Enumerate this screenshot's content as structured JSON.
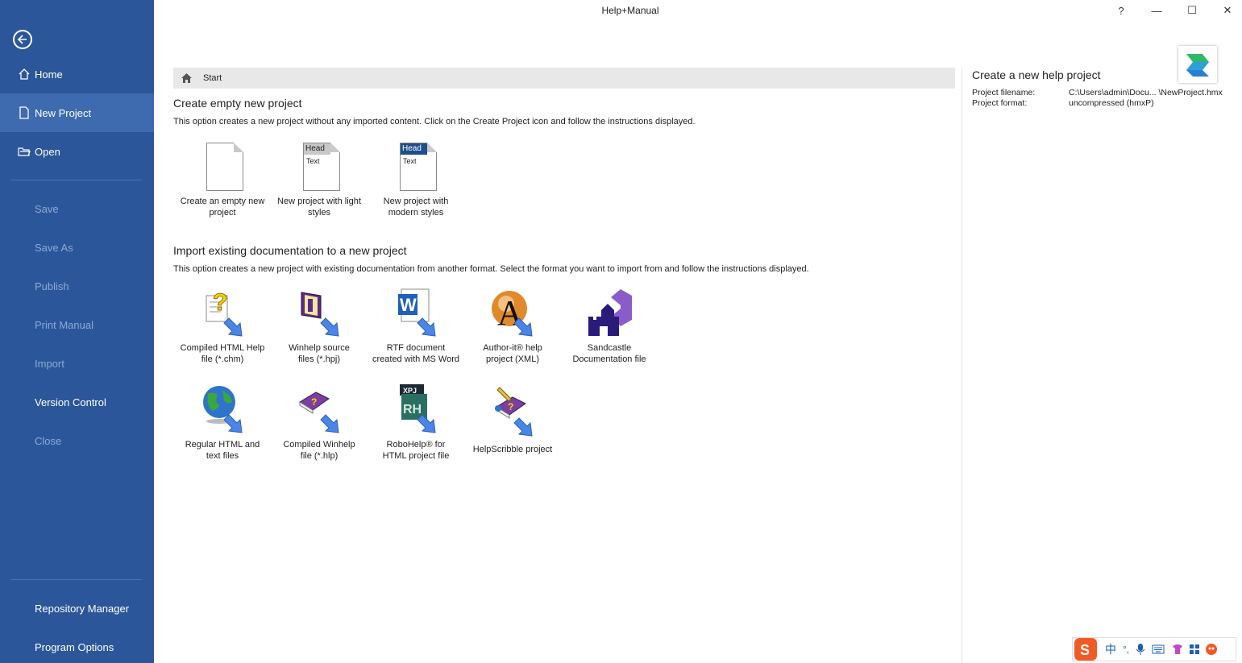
{
  "window": {
    "title": "Help+Manual",
    "help_label": "?",
    "min_label": "—",
    "max_label": "☐",
    "close_label": "✕"
  },
  "sidebar": {
    "items": [
      {
        "label": "Home",
        "icon": "home-icon",
        "state": "normal"
      },
      {
        "label": "New Project",
        "icon": "document-icon",
        "state": "active"
      },
      {
        "label": "Open",
        "icon": "folder-icon",
        "state": "normal"
      },
      {
        "label": "Save",
        "state": "disabled"
      },
      {
        "label": "Save As",
        "state": "disabled"
      },
      {
        "label": "Publish",
        "state": "disabled"
      },
      {
        "label": "Print Manual",
        "state": "disabled"
      },
      {
        "label": "Import",
        "state": "disabled"
      },
      {
        "label": "Version Control",
        "state": "normal"
      },
      {
        "label": "Close",
        "state": "disabled"
      },
      {
        "label": "Repository Manager",
        "state": "normal"
      },
      {
        "label": "Program Options",
        "state": "normal"
      }
    ]
  },
  "breadcrumb": {
    "label": "Start"
  },
  "create_section": {
    "title": "Create empty new project",
    "description": "This option creates a new project without any imported content. Click on the Create Project icon and follow the instructions displayed.",
    "tiles": [
      {
        "line1": "Create an empty new",
        "line2": "project",
        "icon": "blank-document-icon"
      },
      {
        "line1": "New project with light",
        "line2": "styles",
        "icon": "light-styles-document-icon",
        "head": "Head",
        "text": "Text"
      },
      {
        "line1": "New project with",
        "line2": "modern styles",
        "icon": "modern-styles-document-icon",
        "head": "Head",
        "text": "Text"
      }
    ]
  },
  "import_section": {
    "title": "Import existing documentation to a new project",
    "description": "This option creates a new project with existing documentation from another format. Select the format you want to import from and follow the instructions displayed.",
    "tiles": [
      {
        "line1": "Compiled HTML Help",
        "line2": "file (*.chm)",
        "icon": "chm-help-icon"
      },
      {
        "line1": "Winhelp source",
        "line2": "files (*.hpj)",
        "icon": "winhelp-book-icon"
      },
      {
        "line1": "RTF document",
        "line2": "created with MS Word",
        "icon": "ms-word-icon"
      },
      {
        "line1": "Author-it® help",
        "line2": "project (XML)",
        "icon": "author-it-icon"
      },
      {
        "line1": "Sandcastle",
        "line2": "Documentation file",
        "icon": "sandcastle-icon"
      },
      {
        "line1": "Regular HTML and",
        "line2": "text files",
        "icon": "globe-icon"
      },
      {
        "line1": "Compiled Winhelp",
        "line2": "file (*.hlp)",
        "icon": "hlp-book-icon"
      },
      {
        "line1": "RoboHelp® for",
        "line2": "HTML project file",
        "icon": "robohelp-icon",
        "badge1": "XPJ",
        "badge2": "RH"
      },
      {
        "line1": "HelpScribble project",
        "line2": "",
        "icon": "helpscribble-icon"
      }
    ]
  },
  "right_panel": {
    "title": "Create a new help project",
    "filename_label": "Project filename:",
    "filename_value": "C:\\Users\\admin\\Docu... \\NewProject.hmx",
    "format_label": "Project format:",
    "format_value": "uncompressed (hmxP)"
  },
  "tray": {
    "ime_char": "中",
    "punct": "°,"
  },
  "colors": {
    "sidebar": "#2b579a",
    "sidebar_active": "#3e6bb0",
    "sidebar_disabled_text": "#8fa9d2",
    "arrow": "#4a86e8"
  }
}
